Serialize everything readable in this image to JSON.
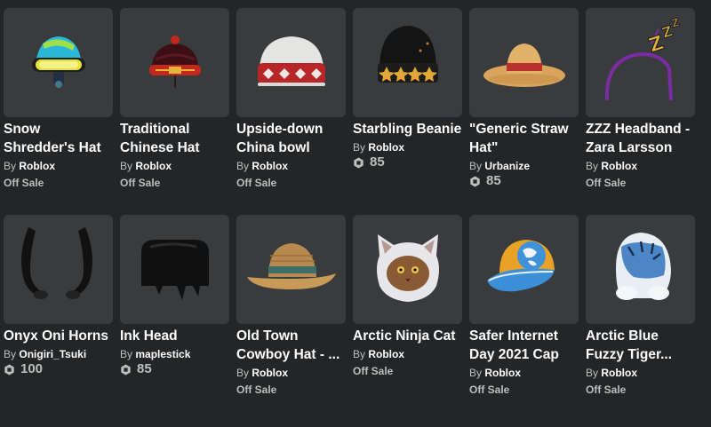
{
  "items": [
    {
      "name": "Snow\nShredder's Hat",
      "by": "By",
      "creator": "Roblox",
      "status": "Off Sale"
    },
    {
      "name": "Traditional\nChinese Hat",
      "by": "By",
      "creator": "Roblox",
      "status": "Off Sale"
    },
    {
      "name": "Upside-down\nChina bowl",
      "by": "By",
      "creator": "Roblox",
      "status": "Off Sale"
    },
    {
      "name": "Starbling Beanie",
      "by": "By",
      "creator": "Roblox",
      "price": "85"
    },
    {
      "name": "\"Generic Straw\nHat\"",
      "by": "By",
      "creator": "Urbanize",
      "price": "85"
    },
    {
      "name": "ZZZ Headband -\nZara Larsson",
      "by": "By",
      "creator": "Roblox",
      "status": "Off Sale"
    },
    {
      "name": "Onyx Oni Horns",
      "by": "By",
      "creator": "Onigiri_Tsuki",
      "price": "100"
    },
    {
      "name": "Ink Head",
      "by": "By",
      "creator": "maplestick",
      "price": "85"
    },
    {
      "name": "Old Town\nCowboy Hat - ...",
      "by": "By",
      "creator": "Roblox",
      "status": "Off Sale"
    },
    {
      "name": "Arctic Ninja Cat",
      "by": "By",
      "creator": "Roblox",
      "status": "Off Sale"
    },
    {
      "name": "Safer Internet\nDay 2021 Cap",
      "by": "By",
      "creator": "Roblox",
      "status": "Off Sale"
    },
    {
      "name": "Arctic Blue\nFuzzy Tiger...",
      "by": "By",
      "creator": "Roblox",
      "status": "Off Sale"
    }
  ],
  "icons": {
    "0": "snow-goggle-helmet",
    "1": "chinese-hat",
    "2": "bowl-hat",
    "3": "star-beanie",
    "4": "straw-hat",
    "5": "zzz-headband",
    "6": "oni-horns",
    "7": "ink-head",
    "8": "cowboy-hat",
    "9": "ninja-cat-hood",
    "10": "globe-cap",
    "11": "tiger-hood"
  },
  "colors": {
    "background": "#232527",
    "thumbnail": "#393b3d",
    "text": "#ffffff",
    "muted": "#bdbebe"
  }
}
